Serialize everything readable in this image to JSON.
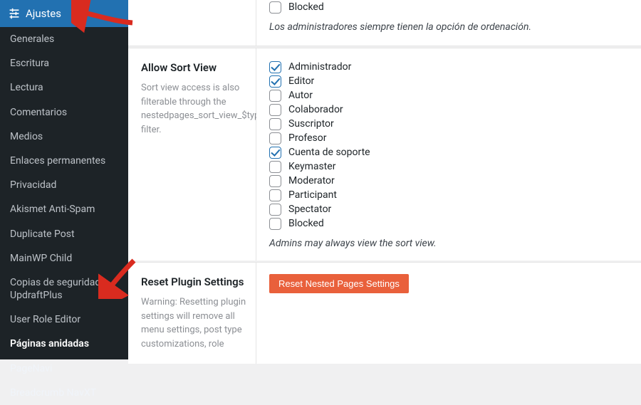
{
  "colors": {
    "accent": "#2271b1",
    "danger": "#e9603b",
    "sidebar_bg": "#1d2327"
  },
  "sidebar": {
    "parent_label": "Ajustes",
    "items": [
      {
        "label": "Generales"
      },
      {
        "label": "Escritura"
      },
      {
        "label": "Lectura"
      },
      {
        "label": "Comentarios"
      },
      {
        "label": "Medios"
      },
      {
        "label": "Enlaces permanentes"
      },
      {
        "label": "Privacidad"
      },
      {
        "label": "Akismet Anti-Spam"
      },
      {
        "label": "Duplicate Post"
      },
      {
        "label": "MainWP Child"
      },
      {
        "label": "Copias de seguridad UpdraftPlus"
      },
      {
        "label": "User Role Editor"
      },
      {
        "label": "Páginas anidadas"
      },
      {
        "label": "PageNavi"
      },
      {
        "label": "Breadcrumb NavXT"
      }
    ],
    "active_index": 12
  },
  "top": {
    "roles": [
      {
        "label": "Blocked",
        "checked": false
      }
    ],
    "note": "Los administradores siempre tienen la opción de ordenación."
  },
  "sort_view": {
    "title": "Allow Sort View",
    "desc": "Sort view access is also filterable through the nestedpages_sort_view_$type filter.",
    "roles": [
      {
        "label": "Administrador",
        "checked": true
      },
      {
        "label": "Editor",
        "checked": true
      },
      {
        "label": "Autor",
        "checked": false
      },
      {
        "label": "Colaborador",
        "checked": false
      },
      {
        "label": "Suscriptor",
        "checked": false
      },
      {
        "label": "Profesor",
        "checked": false
      },
      {
        "label": "Cuenta de soporte",
        "checked": true
      },
      {
        "label": "Keymaster",
        "checked": false
      },
      {
        "label": "Moderator",
        "checked": false
      },
      {
        "label": "Participant",
        "checked": false
      },
      {
        "label": "Spectator",
        "checked": false
      },
      {
        "label": "Blocked",
        "checked": false
      }
    ],
    "note": "Admins may always view the sort view."
  },
  "reset": {
    "title": "Reset Plugin Settings",
    "desc": "Warning: Resetting plugin settings will remove all menu settings, post type customizations, role",
    "button": "Reset Nested Pages Settings"
  }
}
